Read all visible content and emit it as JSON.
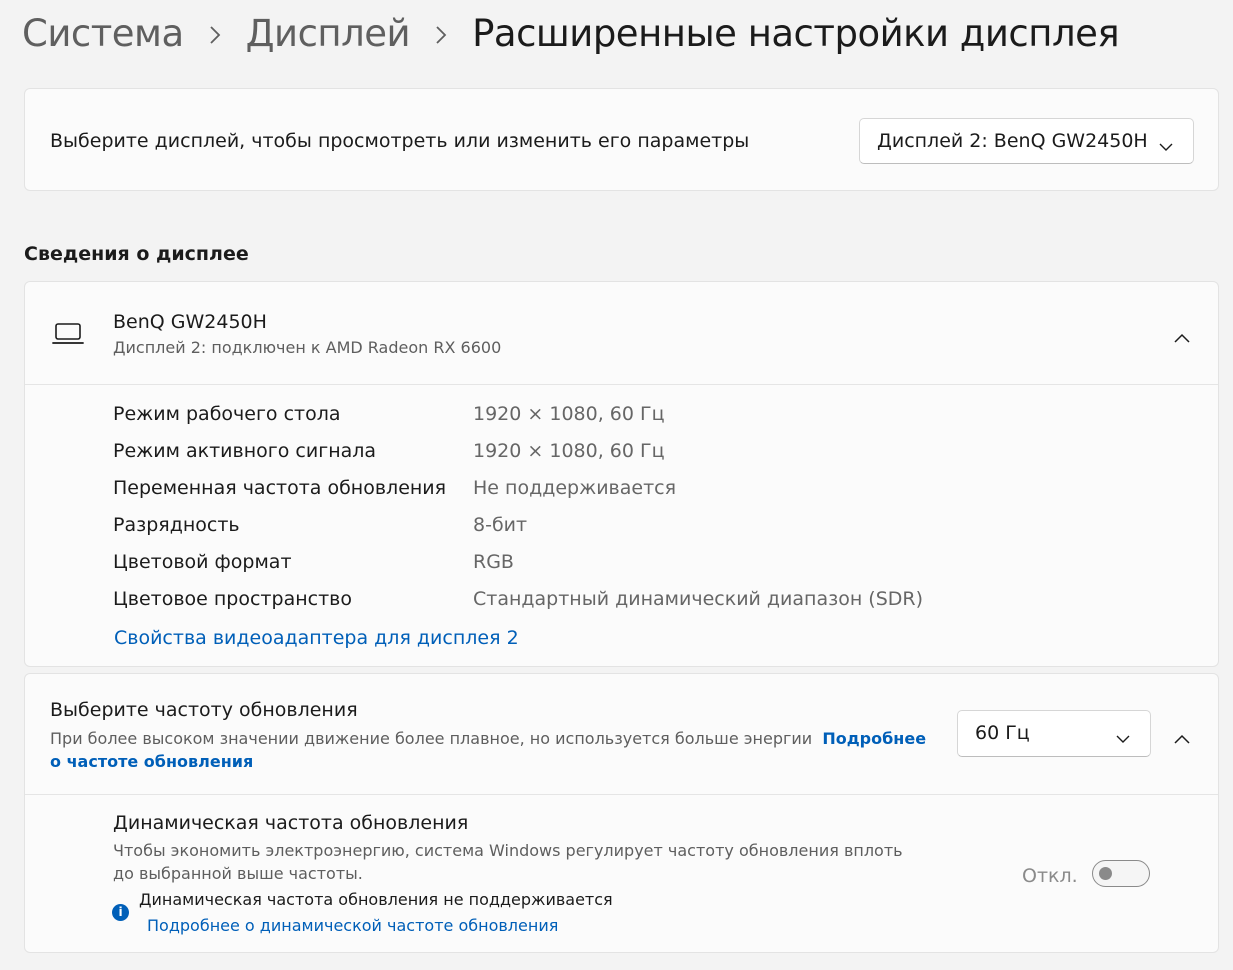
{
  "breadcrumb": {
    "item1": "Система",
    "item2": "Дисплей",
    "current": "Расширенные настройки дисплея"
  },
  "display_select": {
    "label": "Выберите дисплей, чтобы просмотреть или изменить его параметры",
    "value": "Дисплей 2: BenQ GW2450H"
  },
  "section_title": "Сведения о дисплее",
  "display_info": {
    "name": "BenQ GW2450H",
    "subtitle": "Дисплей 2: подключен к AMD Radeon RX 6600",
    "rows": [
      {
        "label": "Режим рабочего стола",
        "value": "1920 × 1080, 60 Гц"
      },
      {
        "label": "Режим активного сигнала",
        "value": "1920 × 1080, 60 Гц"
      },
      {
        "label": "Переменная частота обновления",
        "value": "Не поддерживается"
      },
      {
        "label": "Разрядность",
        "value": "8-бит"
      },
      {
        "label": "Цветовой формат",
        "value": "RGB"
      },
      {
        "label": "Цветовое пространство",
        "value": "Стандартный динамический диапазон (SDR)"
      }
    ],
    "adapter_link": "Свойства видеоадаптера для дисплея 2"
  },
  "refresh": {
    "title": "Выберите частоту обновления",
    "description": "При более высоком значении движение более плавное, но используется больше энергии",
    "more_link": "Подробнее о частоте обновления",
    "value": "60 Гц"
  },
  "dynamic_refresh": {
    "title": "Динамическая частота обновления",
    "description": "Чтобы экономить электроэнергию, система Windows регулирует частоту обновления вплоть до выбранной выше частоты.",
    "toggle_label": "Откл.",
    "toggle_on": false,
    "note": "Динамическая частота обновления не поддерживается",
    "link": "Подробнее о динамической частоте обновления"
  },
  "colors": {
    "accent": "#005fb8",
    "background": "#f3f3f3",
    "card": "#fbfbfb"
  },
  "icons": [
    "chevron-right-icon",
    "chevron-down-icon",
    "chevron-up-icon",
    "laptop-icon",
    "info-icon"
  ]
}
